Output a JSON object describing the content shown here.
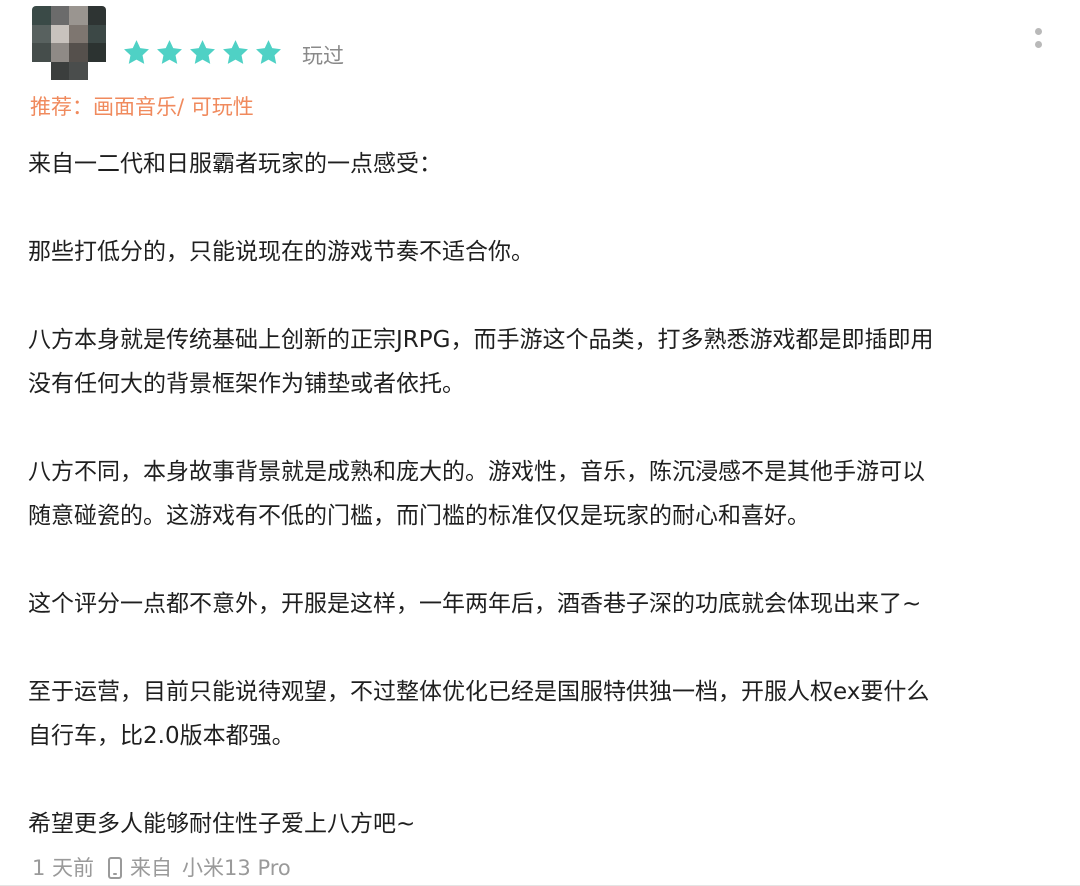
{
  "review": {
    "rating": 5,
    "rating_max": 5,
    "status": "玩过",
    "recommend": "推荐：画面音乐/ 可玩性",
    "paragraphs": [
      "来自一二代和日服霸者玩家的一点感受：",
      "那些打低分的，只能说现在的游戏节奏不适合你。",
      "八方本身就是传统基础上创新的正宗JRPG，而手游这个品类，打多熟悉游戏都是即插即用\n没有任何大的背景框架作为铺垫或者依托。",
      "八方不同，本身故事背景就是成熟和庞大的。游戏性，音乐，陈沉浸感不是其他手游可以\n随意碰瓷的。这游戏有不低的门槛，而门槛的标准仅仅是玩家的耐心和喜好。",
      "这个评分一点都不意外，开服是这样，一年两年后，酒香巷子深的功底就会体现出来了~",
      "至于运营，目前只能说待观望，不过整体优化已经是国服特供独一档，开服人权ex要什么\n自行车，比2.0版本都强。",
      "希望更多人能够耐住性子爱上八方吧~"
    ],
    "footer": {
      "time": "1 天前",
      "from": "来自",
      "device": "小米13 Pro"
    }
  },
  "icons": {
    "star": "star-icon",
    "more": "more-vertical-icon",
    "phone": "phone-icon"
  },
  "colors": {
    "star": "#4fd1c5",
    "recommend": "#f08a5d",
    "muted": "#9a9a9a"
  }
}
